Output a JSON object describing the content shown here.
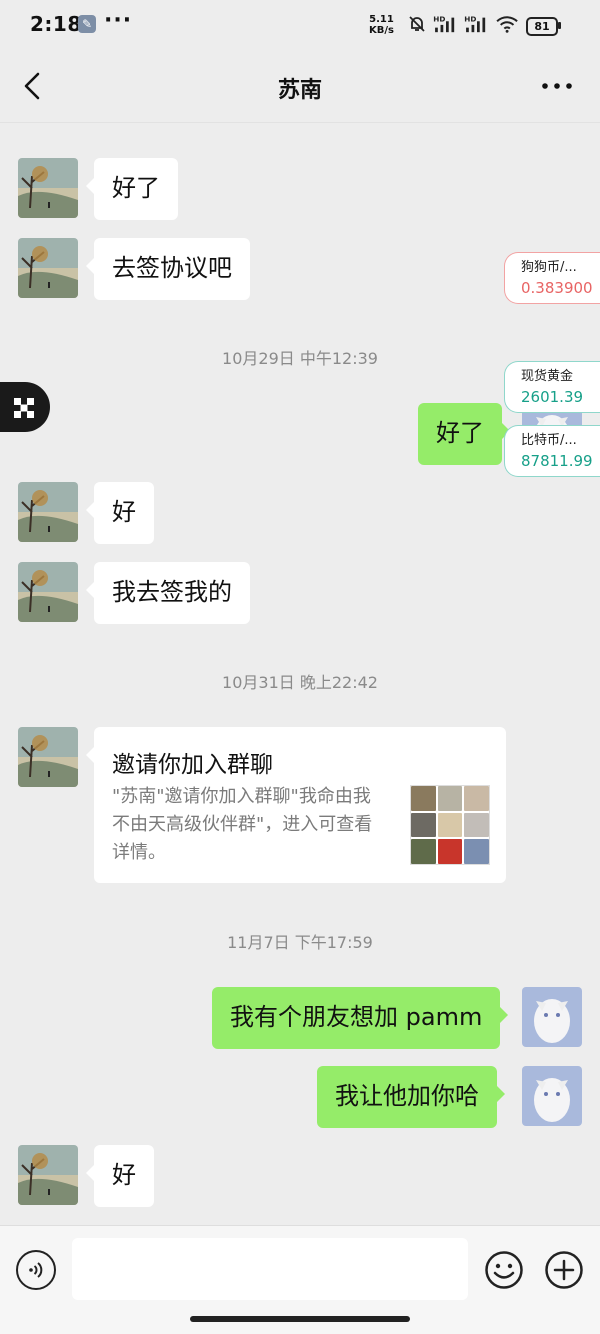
{
  "status_bar": {
    "time": "2:18",
    "more": "···",
    "net_speed_value": "5.11",
    "net_speed_unit": "KB/s",
    "hd1": "HD",
    "hd2": "HD",
    "battery": "81"
  },
  "header": {
    "title": "苏南"
  },
  "messages": [
    {
      "side": "in",
      "text": "好了"
    },
    {
      "side": "in",
      "text": "去签协议吧"
    },
    {
      "side": "time",
      "text": "10月29日 中午12:39"
    },
    {
      "side": "out",
      "text": "好了"
    },
    {
      "side": "in",
      "text": "好"
    },
    {
      "side": "in",
      "text": "我去签我的"
    },
    {
      "side": "time",
      "text": "10月31日 晚上22:42"
    },
    {
      "side": "in",
      "type": "invite",
      "title": "邀请你加入群聊",
      "desc": "\"苏南\"邀请你加入群聊\"我命由我不由天高级伙伴群\"，进入可查看详情。"
    },
    {
      "side": "time",
      "text": "11月7日 下午17:59"
    },
    {
      "side": "out",
      "text": "我有个朋友想加 pamm"
    },
    {
      "side": "out",
      "text": "我让他加你哈"
    },
    {
      "side": "in",
      "text": "好"
    }
  ],
  "widgets": {
    "tickers": [
      {
        "name": "狗狗币/...",
        "value": "0.383900",
        "trend": "down"
      },
      {
        "name": "现货黄金",
        "value": "2601.39",
        "trend": "up"
      },
      {
        "name": "比特币/...",
        "value": "87811.99",
        "trend": "up"
      }
    ]
  },
  "input": {
    "placeholder": ""
  },
  "colors": {
    "background": "#ededed",
    "bubble_out": "#95ec69",
    "bubble_in": "#ffffff",
    "ticker_down": "#e86464",
    "ticker_up": "#17a089"
  },
  "icons": [
    "back-icon",
    "more-icon",
    "voice-icon",
    "emoji-icon",
    "plus-icon"
  ]
}
